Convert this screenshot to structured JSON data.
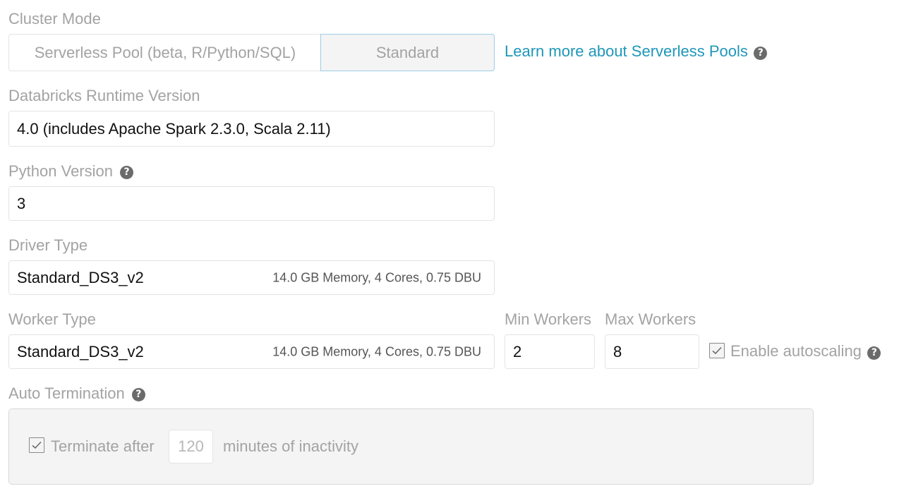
{
  "cluster_mode": {
    "label": "Cluster Mode",
    "options": [
      "Serverless Pool (beta, R/Python/SQL)",
      "Standard"
    ],
    "selected": "Standard",
    "learn_more_link": "Learn more about Serverless Pools"
  },
  "runtime": {
    "label": "Databricks Runtime Version",
    "value": "4.0 (includes Apache Spark 2.3.0, Scala 2.11)"
  },
  "python": {
    "label": "Python Version",
    "value": "3"
  },
  "driver": {
    "label": "Driver Type",
    "value": "Standard_DS3_v2",
    "meta": "14.0 GB Memory, 4 Cores, 0.75 DBU"
  },
  "worker": {
    "label": "Worker Type",
    "value": "Standard_DS3_v2",
    "meta": "14.0 GB Memory, 4 Cores, 0.75 DBU",
    "min_label": "Min Workers",
    "min_value": "2",
    "max_label": "Max Workers",
    "max_value": "8",
    "autoscaling_label": "Enable autoscaling",
    "autoscaling_checked": true
  },
  "auto_termination": {
    "label": "Auto Termination",
    "checked": true,
    "prefix": "Terminate after",
    "minutes": "120",
    "suffix": "minutes of inactivity"
  },
  "colors": {
    "link": "#1f97b8",
    "selected_border": "#9fcde6",
    "muted_text": "#a3a3a3",
    "panel_bg": "#f4f4f4"
  },
  "icons": [
    "help-icon",
    "checkbox-checked-icon"
  ]
}
